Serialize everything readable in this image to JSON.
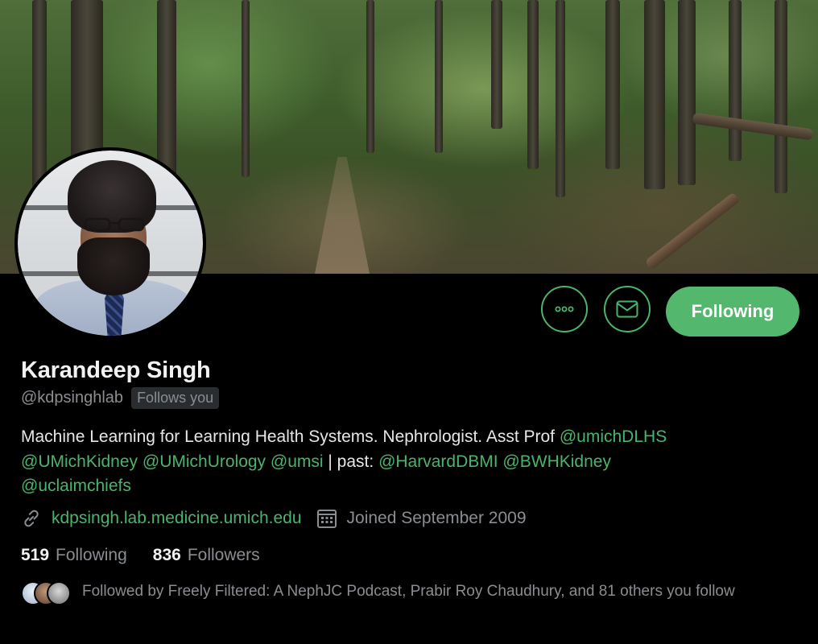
{
  "profile": {
    "name": "Karandeep Singh",
    "handle": "@kdpsinghlab",
    "follows_you": "Follows you",
    "bio": {
      "text1": "Machine Learning for Learning Health Systems. Nephrologist. Asst Prof ",
      "mention_umichdlhs": "@umichDLHS",
      "mention_umichkidney": "@UMichKidney",
      "mention_umichurology": "@UMichUrology",
      "mention_umsi": "@umsi",
      "text2": " | past: ",
      "mention_harvarddbmi": "@HarvardDBMI",
      "mention_bwhkidney": "@BWHKidney",
      "mention_uclaimchiefs": "@uclaimchiefs"
    },
    "website": "kdpsingh.lab.medicine.umich.edu",
    "joined": "Joined September 2009",
    "following_count": "519",
    "following_label": "Following",
    "followers_count": "836",
    "followers_label": "Followers",
    "followed_by": "Followed by Freely Filtered: A NephJC Podcast, Prabir Roy Chaudhury, and 81 others you follow"
  },
  "actions": {
    "more_icon": "more-horizontal-icon",
    "message_icon": "mail-icon",
    "following_button": "Following"
  },
  "colors": {
    "accent": "#4ab56a",
    "follow_button_bg": "#53b76e",
    "background": "#000000",
    "muted_text": "#8a8d91"
  }
}
